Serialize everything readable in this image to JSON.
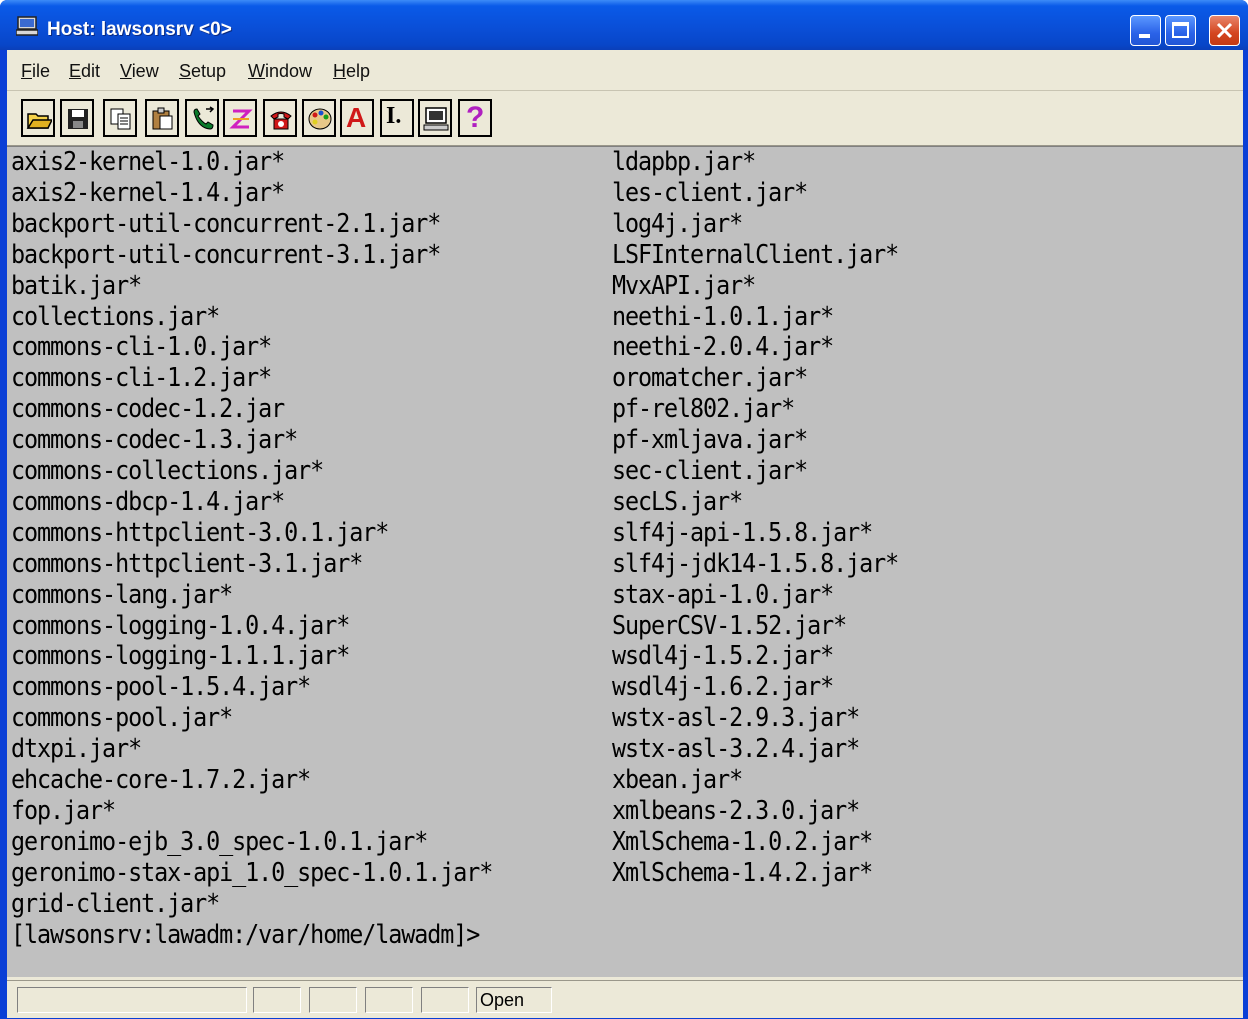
{
  "window": {
    "title": "Host: lawsonsrv <0>",
    "accent": "#0a4fd8",
    "terminal_background": "#c0c0c0"
  },
  "menu": [
    {
      "label": "File",
      "u": "F",
      "rest": "ile"
    },
    {
      "label": "Edit",
      "u": "E",
      "rest": "dit"
    },
    {
      "label": "View",
      "u": "V",
      "rest": "iew"
    },
    {
      "label": "Setup",
      "u": "S",
      "rest": "etup"
    },
    {
      "label": "Window",
      "u": "W",
      "rest": "indow"
    },
    {
      "label": "Help",
      "u": "H",
      "rest": "elp"
    }
  ],
  "toolbar": {
    "buttons": [
      "open-icon",
      "save-icon",
      "copy-icon",
      "paste-icon",
      "phone-connect-icon",
      "disconnect-icon",
      "phone-dial-icon",
      "palette-icon",
      "font-icon",
      "cursor-icon",
      "terminal-icon",
      "help-icon"
    ],
    "font_glyph": "A",
    "cursor_glyph": "I.",
    "help_glyph": "?"
  },
  "terminal": {
    "left_column": [
      "axis2-kernel-1.0.jar*",
      "axis2-kernel-1.4.jar*",
      "backport-util-concurrent-2.1.jar*",
      "backport-util-concurrent-3.1.jar*",
      "batik.jar*",
      "collections.jar*",
      "commons-cli-1.0.jar*",
      "commons-cli-1.2.jar*",
      "commons-codec-1.2.jar",
      "commons-codec-1.3.jar*",
      "commons-collections.jar*",
      "commons-dbcp-1.4.jar*",
      "commons-httpclient-3.0.1.jar*",
      "commons-httpclient-3.1.jar*",
      "commons-lang.jar*",
      "commons-logging-1.0.4.jar*",
      "commons-logging-1.1.1.jar*",
      "commons-pool-1.5.4.jar*",
      "commons-pool.jar*",
      "dtxpi.jar*",
      "ehcache-core-1.7.2.jar*",
      "fop.jar*",
      "geronimo-ejb_3.0_spec-1.0.1.jar*",
      "geronimo-stax-api_1.0_spec-1.0.1.jar*",
      "grid-client.jar*"
    ],
    "right_column": [
      "ldapbp.jar*",
      "les-client.jar*",
      "log4j.jar*",
      "LSFInternalClient.jar*",
      "MvxAPI.jar*",
      "neethi-1.0.1.jar*",
      "neethi-2.0.4.jar*",
      "oromatcher.jar*",
      "pf-rel802.jar*",
      "pf-xmljava.jar*",
      "sec-client.jar*",
      "secLS.jar*",
      "slf4j-api-1.5.8.jar*",
      "slf4j-jdk14-1.5.8.jar*",
      "stax-api-1.0.jar*",
      "SuperCSV-1.52.jar*",
      "wsdl4j-1.5.2.jar*",
      "wsdl4j-1.6.2.jar*",
      "wstx-asl-2.9.3.jar*",
      "wstx-asl-3.2.4.jar*",
      "xbean.jar*",
      "xmlbeans-2.3.0.jar*",
      "XmlSchema-1.0.2.jar*",
      "XmlSchema-1.4.2.jar*"
    ],
    "prompt": "[lawsonsrv:lawadm:/var/home/lawadm]>"
  },
  "status": {
    "state": "Open"
  }
}
